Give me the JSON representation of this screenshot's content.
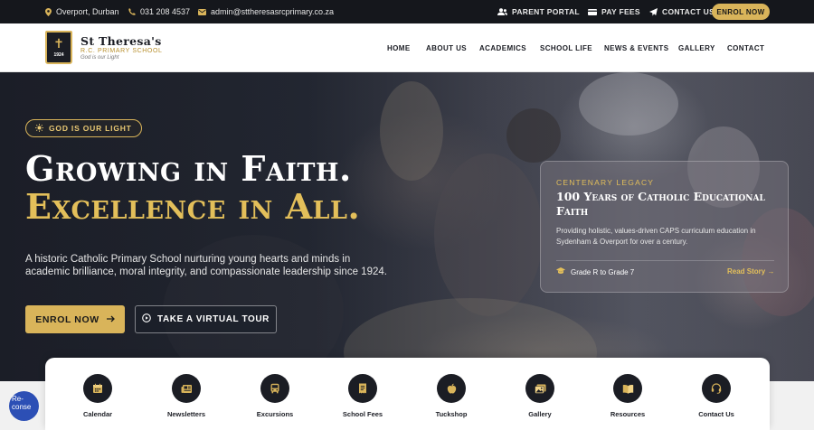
{
  "topbar": {
    "location": "Overport, Durban",
    "phone": "031 208 4537",
    "email": "admin@sttheresasrcprimary.co.za",
    "parent_portal": "PARENT PORTAL",
    "pay_fees": "PAY FEES",
    "contact_us": "CONTACT US",
    "enrol_now": "ENROL NOW"
  },
  "brand": {
    "name": "St Theresa's",
    "subtitle": "R.C. PRIMARY SCHOOL",
    "motto": "God is our Light",
    "crest_year": "1924"
  },
  "nav": [
    "HOME",
    "ABOUT US",
    "ACADEMICS",
    "SCHOOL LIFE",
    "NEWS & EVENTS",
    "GALLERY",
    "CONTACT"
  ],
  "hero": {
    "badge": "GOD IS OUR LIGHT",
    "headline_1": "Growing in Faith.",
    "headline_2": "Excellence in All.",
    "description": "A historic Catholic Primary School nurturing young hearts and minds in academic brilliance, moral integrity, and compassionate leadership since 1924.",
    "enrol_button": "ENROL NOW",
    "tour_button": "TAKE A VIRTUAL TOUR"
  },
  "card": {
    "kicker": "CENTENARY LEGACY",
    "title": "100 Years of Catholic Educational Faith",
    "body": "Providing holistic, values-driven CAPS curriculum education in Sydenham & Overport for over a century.",
    "grades": "Grade R to Grade 7",
    "link": "Read Story →"
  },
  "quick_links": [
    {
      "label": "Calendar",
      "icon": "calendar-icon"
    },
    {
      "label": "Newsletters",
      "icon": "newspaper-icon"
    },
    {
      "label": "Excursions",
      "icon": "bus-icon"
    },
    {
      "label": "School Fees",
      "icon": "receipt-icon"
    },
    {
      "label": "Tuckshop",
      "icon": "apple-icon"
    },
    {
      "label": "Gallery",
      "icon": "images-icon"
    },
    {
      "label": "Resources",
      "icon": "book-icon"
    },
    {
      "label": "Contact Us",
      "icon": "headset-icon"
    }
  ],
  "recaptcha_alt": "Re-conse",
  "colors": {
    "gold": "#d9b45a",
    "navy": "#1b1d24",
    "topbar_bg": "#15171c"
  }
}
